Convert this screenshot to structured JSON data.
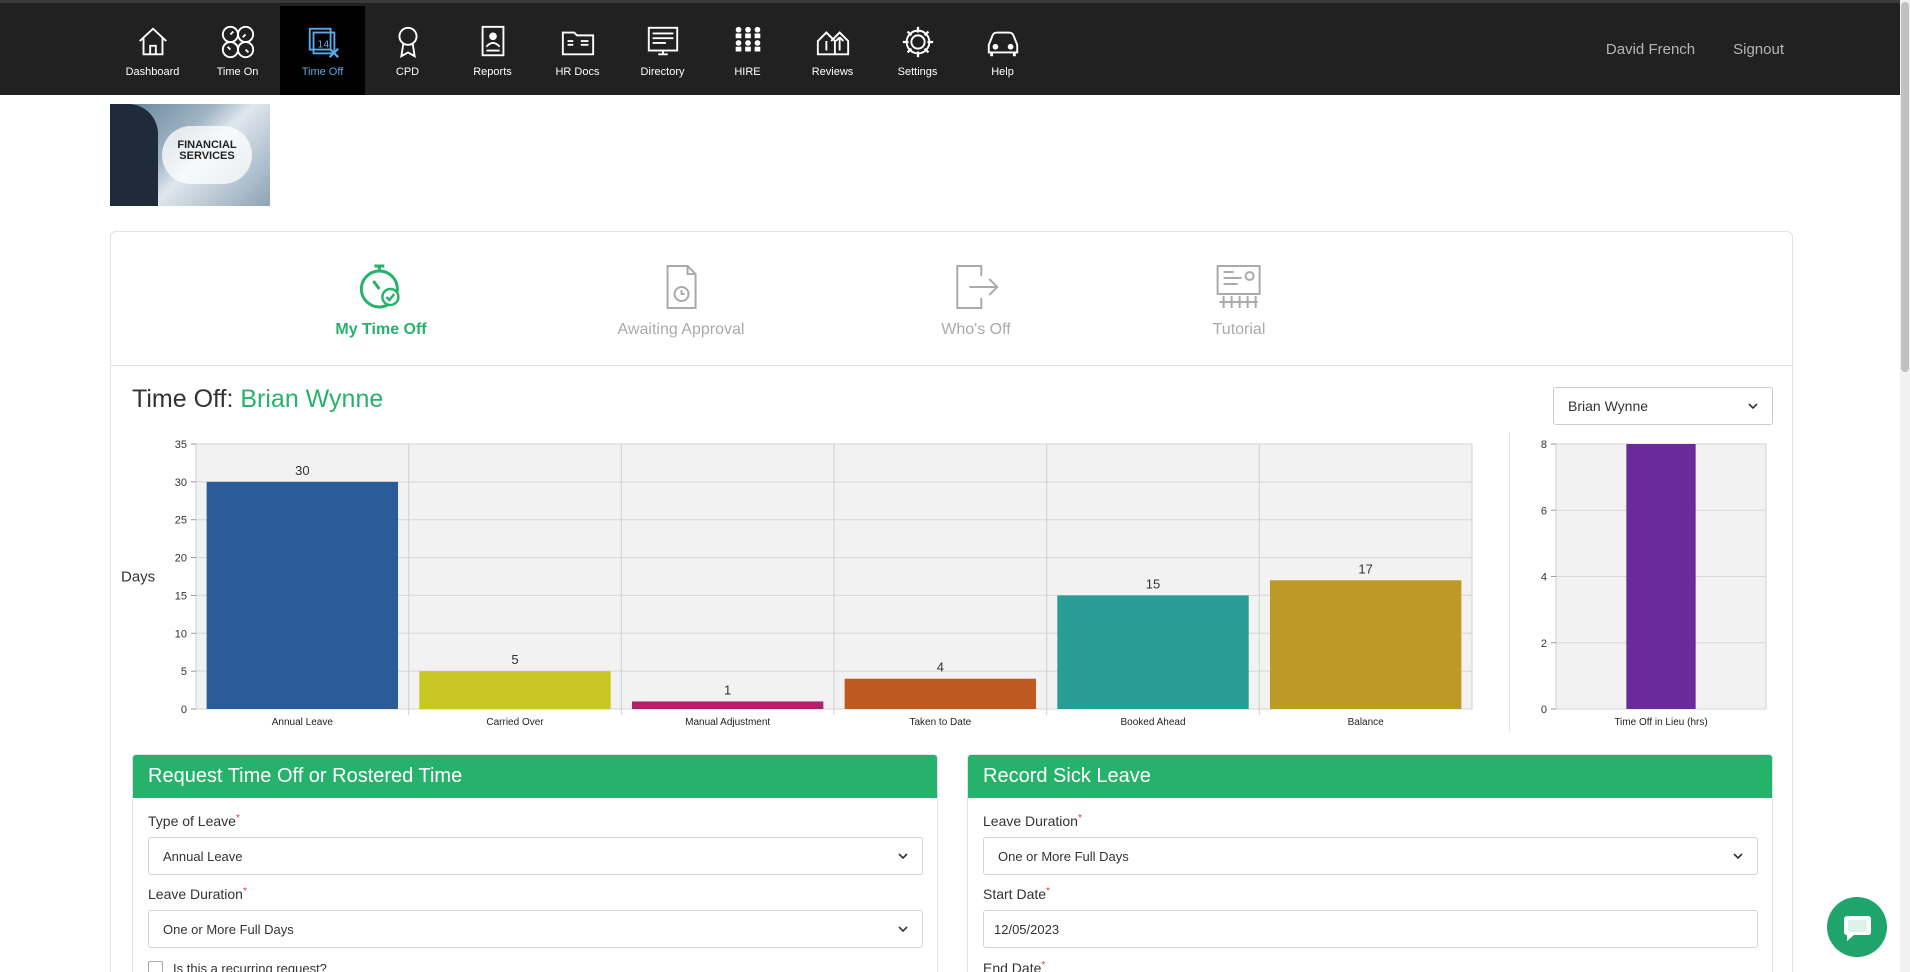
{
  "nav": {
    "items": [
      {
        "label": "Dashboard",
        "icon": "home-icon"
      },
      {
        "label": "Time On",
        "icon": "clocks-icon"
      },
      {
        "label": "Time Off",
        "icon": "calendar-off-icon"
      },
      {
        "label": "CPD",
        "icon": "award-icon"
      },
      {
        "label": "Reports",
        "icon": "report-icon"
      },
      {
        "label": "HR Docs",
        "icon": "folder-icon"
      },
      {
        "label": "Directory",
        "icon": "directory-icon"
      },
      {
        "label": "HIRE",
        "icon": "people-grid-icon"
      },
      {
        "label": "Reviews",
        "icon": "reviews-icon"
      },
      {
        "label": "Settings",
        "icon": "gear-icon"
      },
      {
        "label": "Help",
        "icon": "car-icon"
      }
    ],
    "active_index": 2,
    "user_name": "David French",
    "signout": "Signout"
  },
  "banner": {
    "text_line1": "FINANCIAL",
    "text_line2": "SERVICES"
  },
  "tabs": [
    {
      "label": "My Time Off",
      "icon": "stopwatch-check-icon"
    },
    {
      "label": "Awaiting Approval",
      "icon": "document-clock-icon"
    },
    {
      "label": "Who's Off",
      "icon": "exit-icon"
    },
    {
      "label": "Tutorial",
      "icon": "presentation-icon"
    }
  ],
  "title": {
    "prefix": "Time Off:",
    "employee": "Brian Wynne"
  },
  "employee_select": {
    "value": "Brian Wynne"
  },
  "colors": {
    "accent": "#26b26b",
    "nav_bg": "#212121"
  },
  "chart_data": [
    {
      "type": "bar",
      "ylabel": "Days",
      "ylim": [
        0,
        35
      ],
      "yticks": [
        0,
        5,
        10,
        15,
        20,
        25,
        30,
        35
      ],
      "grid": true,
      "categories": [
        "Annual Leave",
        "Carried Over",
        "Manual Adjustment",
        "Taken to Date",
        "Booked Ahead",
        "Balance"
      ],
      "values": [
        30,
        5,
        1,
        4,
        15,
        17
      ],
      "colors": [
        "#2b5c9a",
        "#c8c723",
        "#b0226a",
        "#be5a20",
        "#2a9c96",
        "#bd9a25"
      ]
    },
    {
      "type": "bar",
      "ylim": [
        0,
        8
      ],
      "yticks": [
        0,
        2,
        4,
        6,
        8
      ],
      "grid": true,
      "categories": [
        "Time Off in Lieu (hrs)"
      ],
      "values": [
        8
      ],
      "colors": [
        "#6a2a9a"
      ]
    }
  ],
  "request_panel": {
    "title": "Request Time Off or Rostered Time",
    "type_label": "Type of Leave",
    "type_value": "Annual Leave",
    "duration_label": "Leave Duration",
    "duration_value": "One or More Full Days",
    "recurring_label": "Is this a recurring request?"
  },
  "sick_panel": {
    "title": "Record Sick Leave",
    "duration_label": "Leave Duration",
    "duration_value": "One or More Full Days",
    "start_label": "Start Date",
    "start_value": "12/05/2023",
    "end_label": "End Date"
  },
  "required_marker": "*"
}
